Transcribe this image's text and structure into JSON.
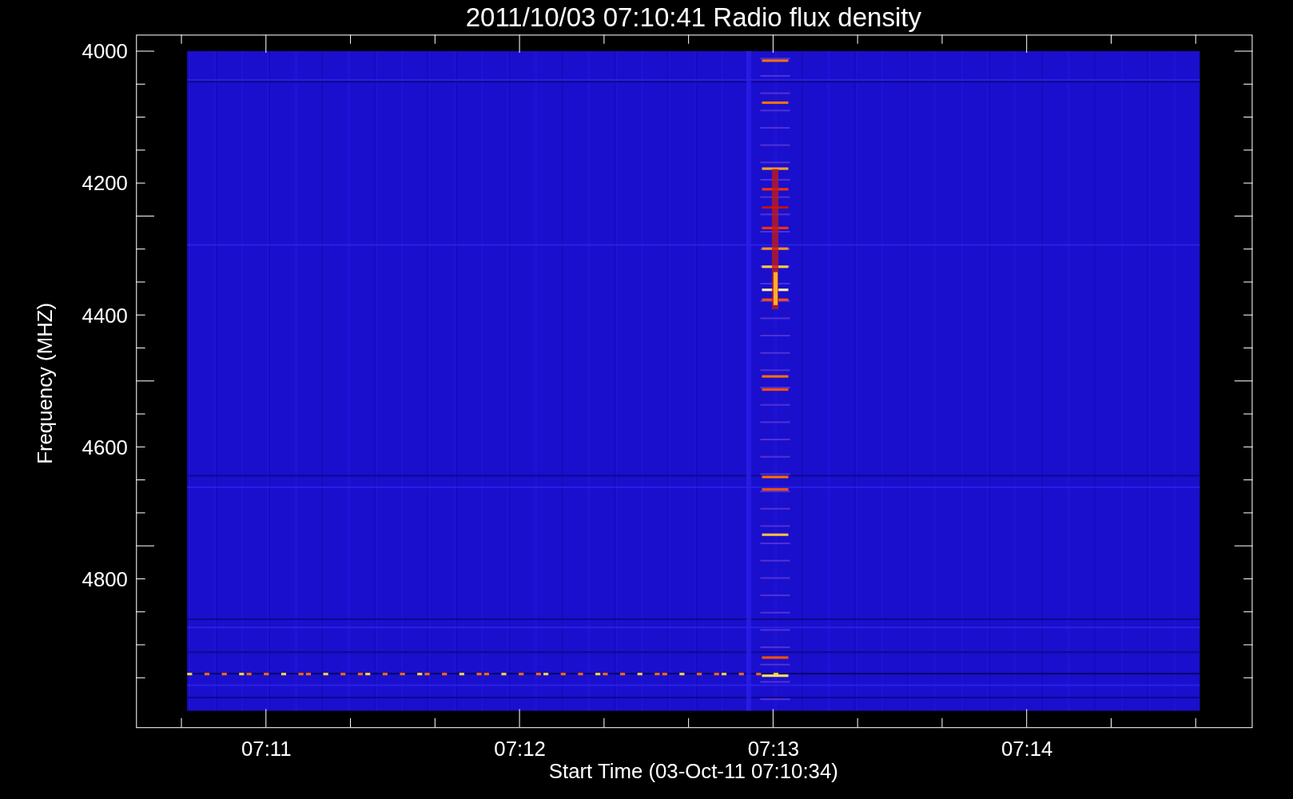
{
  "title": "2011/10/03 07:10:41 Radio flux density",
  "y_axis": {
    "label": "Frequency (MHZ)",
    "ticks": [
      "4000",
      "4200",
      "4400",
      "4600",
      "4800"
    ]
  },
  "x_axis": {
    "label": "Start Time (03-Oct-11 07:10:34)",
    "ticks": [
      "07:11",
      "07:12",
      "07:13",
      "07:14"
    ]
  }
}
